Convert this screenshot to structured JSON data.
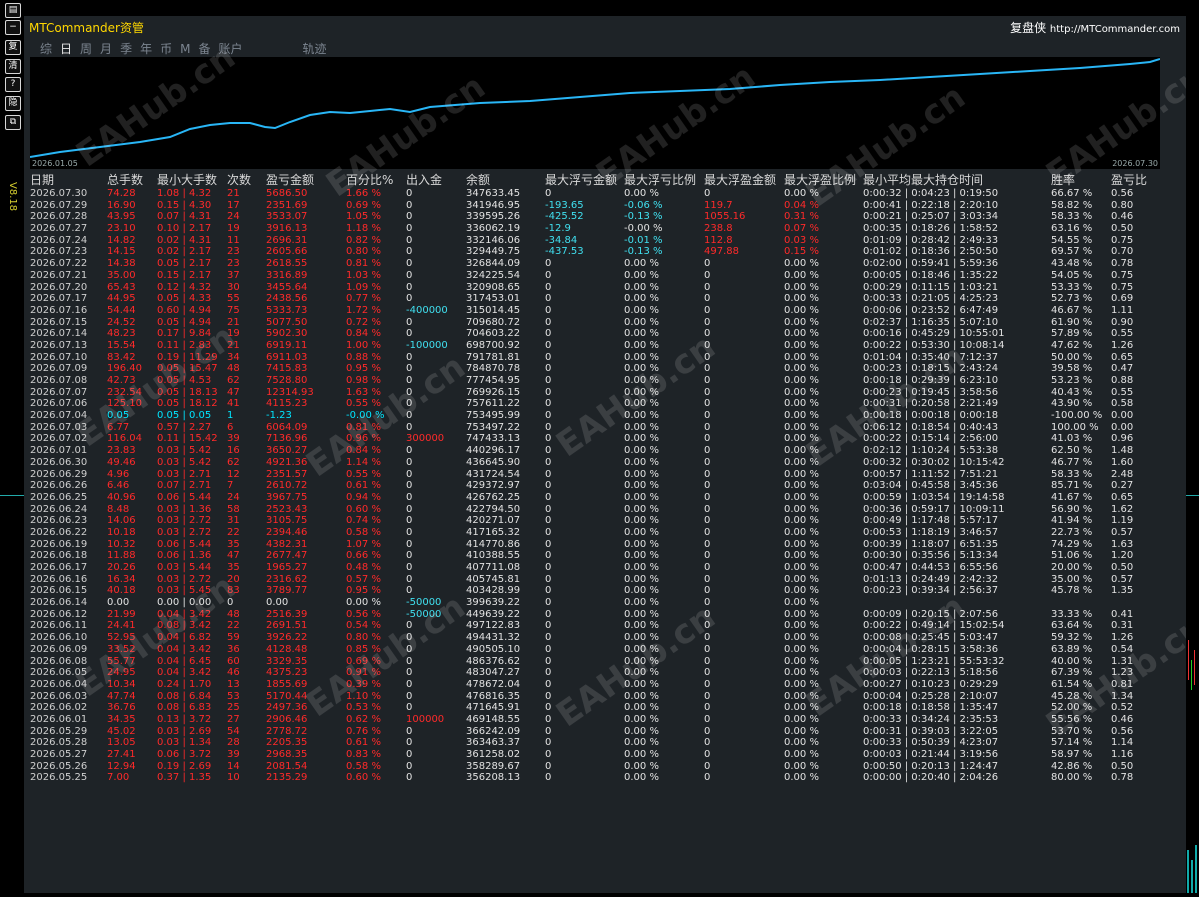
{
  "window": {
    "title": "MTCommander资管",
    "brand": "复盘侠",
    "url": "http://MTCommander.com",
    "version": "V8.18"
  },
  "tabs": [
    "综",
    "日",
    "周",
    "月",
    "季",
    "年",
    "币",
    "M",
    "备",
    "账户",
    "轨迹"
  ],
  "active_tab": "日",
  "chart": {
    "start_label": "2026.01.05",
    "end_label": "2026.07.30",
    "line_color": "#29b6f6"
  },
  "watermark": "EAHub.cn",
  "table": {
    "headers": [
      "日期",
      "总手数",
      "最小大手数",
      "次数",
      "盈亏金额",
      "百分比%",
      "出入金",
      "余额",
      "最大浮亏金额",
      "最大浮亏比例",
      "最大浮盈金额",
      "最大浮盈比例",
      "最小平均最大持仓时间",
      "胜率",
      "盈亏比"
    ],
    "rows": [
      [
        "2026.07.30",
        "74.28",
        "1.08 | 4.32",
        "21",
        "5686.50",
        "1.66 %",
        "0",
        "347633.45",
        "0",
        "0.00 %",
        "0",
        "0.00 %",
        "0:00:32 | 0:04:23 | 0:19:50",
        "66.67 %",
        "0.56"
      ],
      [
        "2026.07.29",
        "16.90",
        "0.15 | 4.30",
        "17",
        "2351.69",
        "0.69 %",
        "0",
        "341946.95",
        "-193.65",
        "-0.06 %",
        "119.7",
        "0.04 %",
        "0:00:41 | 0:22:18 | 2:20:10",
        "58.82 %",
        "0.80"
      ],
      [
        "2026.07.28",
        "43.95",
        "0.07 | 4.31",
        "24",
        "3533.07",
        "1.05 %",
        "0",
        "339595.26",
        "-425.52",
        "-0.13 %",
        "1055.16",
        "0.31 %",
        "0:00:21 | 0:25:07 | 3:03:34",
        "58.33 %",
        "0.46"
      ],
      [
        "2026.07.27",
        "23.10",
        "0.10 | 2.17",
        "19",
        "3916.13",
        "1.18 %",
        "0",
        "336062.19",
        "-12.9",
        "-0.00 %",
        "238.8",
        "0.07 %",
        "0:00:35 | 0:18:26 | 1:58:52",
        "63.16 %",
        "0.50"
      ],
      [
        "2026.07.24",
        "14.82",
        "0.02 | 4.31",
        "11",
        "2696.31",
        "0.82 %",
        "0",
        "332146.06",
        "-34.84",
        "-0.01 %",
        "112.8",
        "0.03 %",
        "0:01:09 | 0:28:42 | 2:49:33",
        "54.55 %",
        "0.75"
      ],
      [
        "2026.07.23",
        "14.15",
        "0.02 | 2.17",
        "23",
        "2605.66",
        "0.80 %",
        "0",
        "329449.75",
        "-437.53",
        "-0.13 %",
        "497.88",
        "0.15 %",
        "0:01:02 | 0:18:36 | 2:50:50",
        "69.57 %",
        "0.70"
      ],
      [
        "2026.07.22",
        "14.38",
        "0.05 | 2.17",
        "23",
        "2618.55",
        "0.81 %",
        "0",
        "326844.09",
        "0",
        "0.00 %",
        "0",
        "0.00 %",
        "0:02:00 | 0:59:41 | 5:59:36",
        "43.48 %",
        "0.78"
      ],
      [
        "2026.07.21",
        "35.00",
        "0.15 | 2.17",
        "37",
        "3316.89",
        "1.03 %",
        "0",
        "324225.54",
        "0",
        "0.00 %",
        "0",
        "0.00 %",
        "0:00:05 | 0:18:46 | 1:35:22",
        "54.05 %",
        "0.75"
      ],
      [
        "2026.07.20",
        "65.43",
        "0.12 | 4.32",
        "30",
        "3455.64",
        "1.09 %",
        "0",
        "320908.65",
        "0",
        "0.00 %",
        "0",
        "0.00 %",
        "0:00:29 | 0:11:15 | 1:03:21",
        "53.33 %",
        "0.75"
      ],
      [
        "2026.07.17",
        "44.95",
        "0.05 | 4.33",
        "55",
        "2438.56",
        "0.77 %",
        "0",
        "317453.01",
        "0",
        "0.00 %",
        "0",
        "0.00 %",
        "0:00:33 | 0:21:05 | 4:25:23",
        "52.73 %",
        "0.69"
      ],
      [
        "2026.07.16",
        "54.44",
        "0.60 | 4.94",
        "75",
        "5333.73",
        "1.72 %",
        "-400000",
        "315014.45",
        "0",
        "0.00 %",
        "0",
        "0.00 %",
        "0:00:06 | 0:23:52 | 6:47:49",
        "46.67 %",
        "1.11"
      ],
      [
        "2026.07.15",
        "24.52",
        "0.05 | 4.94",
        "21",
        "5077.50",
        "0.72 %",
        "0",
        "709680.72",
        "0",
        "0.00 %",
        "0",
        "0.00 %",
        "0:02:37 | 1:16:35 | 5:07:10",
        "61.90 %",
        "0.90"
      ],
      [
        "2026.07.14",
        "48.23",
        "0.17 | 9.84",
        "19",
        "5902.30",
        "0.84 %",
        "0",
        "704603.22",
        "0",
        "0.00 %",
        "0",
        "0.00 %",
        "0:00:16 | 0:45:29 | 10:55:01",
        "57.89 %",
        "0.55"
      ],
      [
        "2026.07.13",
        "15.54",
        "0.11 | 2.83",
        "21",
        "6919.11",
        "1.00 %",
        "-100000",
        "698700.92",
        "0",
        "0.00 %",
        "0",
        "0.00 %",
        "0:00:22 | 0:53:30 | 10:08:14",
        "47.62 %",
        "1.26"
      ],
      [
        "2026.07.10",
        "83.42",
        "0.19 | 11.29",
        "34",
        "6911.03",
        "0.88 %",
        "0",
        "791781.81",
        "0",
        "0.00 %",
        "0",
        "0.00 %",
        "0:01:04 | 0:35:40 | 7:12:37",
        "50.00 %",
        "0.65"
      ],
      [
        "2026.07.09",
        "196.40",
        "0.05 | 15.47",
        "48",
        "7415.83",
        "0.95 %",
        "0",
        "784870.78",
        "0",
        "0.00 %",
        "0",
        "0.00 %",
        "0:00:23 | 0:18:15 | 2:43:24",
        "39.58 %",
        "0.47"
      ],
      [
        "2026.07.08",
        "42.73",
        "0.05 | 4.53",
        "62",
        "7528.80",
        "0.98 %",
        "0",
        "777454.95",
        "0",
        "0.00 %",
        "0",
        "0.00 %",
        "0:00:18 | 0:29:39 | 6:23:10",
        "53.23 %",
        "0.88"
      ],
      [
        "2026.07.07",
        "232.54",
        "0.05 | 18.13",
        "47",
        "12314.93",
        "1.63 %",
        "0",
        "769926.15",
        "0",
        "0.00 %",
        "0",
        "0.00 %",
        "0:00:23 | 0:19:45 | 3:58:56",
        "40.43 %",
        "0.55"
      ],
      [
        "2026.07.06",
        "125.10",
        "0.05 | 18.12",
        "41",
        "4115.23",
        "0.55 %",
        "0",
        "757611.22",
        "0",
        "0.00 %",
        "0",
        "0.00 %",
        "0:00:31 | 0:20:58 | 2:21:49",
        "43.90 %",
        "0.58"
      ],
      [
        "2026.07.04",
        "0.05",
        "0.05 | 0.05",
        "1",
        "-1.23",
        "-0.00 %",
        "0",
        "753495.99",
        "0",
        "0.00 %",
        "0",
        "0.00 %",
        "0:00:18 | 0:00:18 | 0:00:18",
        "-100.00 %",
        "0.00"
      ],
      [
        "2026.07.03",
        "6.77",
        "0.57 | 2.27",
        "6",
        "6064.09",
        "0.81 %",
        "0",
        "753497.22",
        "0",
        "0.00 %",
        "0",
        "0.00 %",
        "0:06:12 | 0:18:54 | 0:40:43",
        "100.00 %",
        "0.00"
      ],
      [
        "2026.07.02",
        "116.04",
        "0.11 | 15.42",
        "39",
        "7136.96",
        "0.96 %",
        "300000",
        "747433.13",
        "0",
        "0.00 %",
        "0",
        "0.00 %",
        "0:00:22 | 0:15:14 | 2:56:00",
        "41.03 %",
        "0.96"
      ],
      [
        "2026.07.01",
        "23.83",
        "0.03 | 5.42",
        "16",
        "3650.27",
        "0.84 %",
        "0",
        "440296.17",
        "0",
        "0.00 %",
        "0",
        "0.00 %",
        "0:02:12 | 1:10:24 | 5:53:38",
        "62.50 %",
        "1.48"
      ],
      [
        "2026.06.30",
        "49.46",
        "0.03 | 5.42",
        "62",
        "4921.36",
        "1.14 %",
        "0",
        "436645.90",
        "0",
        "0.00 %",
        "0",
        "0.00 %",
        "0:00:32 | 0:30:02 | 10:15:42",
        "46.77 %",
        "1.60"
      ],
      [
        "2026.06.29",
        "4.96",
        "0.03 | 2.71",
        "12",
        "2351.57",
        "0.55 %",
        "0",
        "431724.54",
        "0",
        "0.00 %",
        "0",
        "0.00 %",
        "0:00:57 | 1:11:52 | 7:51:21",
        "58.33 %",
        "2.48"
      ],
      [
        "2026.06.26",
        "6.46",
        "0.07 | 2.71",
        "7",
        "2610.72",
        "0.61 %",
        "0",
        "429372.97",
        "0",
        "0.00 %",
        "0",
        "0.00 %",
        "0:03:04 | 0:45:58 | 3:45:36",
        "85.71 %",
        "0.27"
      ],
      [
        "2026.06.25",
        "40.96",
        "0.06 | 5.44",
        "24",
        "3967.75",
        "0.94 %",
        "0",
        "426762.25",
        "0",
        "0.00 %",
        "0",
        "0.00 %",
        "0:00:59 | 1:03:54 | 19:14:58",
        "41.67 %",
        "0.65"
      ],
      [
        "2026.06.24",
        "8.48",
        "0.03 | 1.36",
        "58",
        "2523.43",
        "0.60 %",
        "0",
        "422794.50",
        "0",
        "0.00 %",
        "0",
        "0.00 %",
        "0:00:36 | 0:59:17 | 10:09:11",
        "56.90 %",
        "1.62"
      ],
      [
        "2026.06.23",
        "14.06",
        "0.03 | 2.72",
        "31",
        "3105.75",
        "0.74 %",
        "0",
        "420271.07",
        "0",
        "0.00 %",
        "0",
        "0.00 %",
        "0:00:49 | 1:17:48 | 5:57:17",
        "41.94 %",
        "1.19"
      ],
      [
        "2026.06.22",
        "10.18",
        "0.03 | 2.72",
        "22",
        "2394.46",
        "0.58 %",
        "0",
        "417165.32",
        "0",
        "0.00 %",
        "0",
        "0.00 %",
        "0:00:53 | 1:18:19 | 3:46:57",
        "22.73 %",
        "0.57"
      ],
      [
        "2026.06.19",
        "10.32",
        "0.06 | 5.44",
        "35",
        "4382.31",
        "1.07 %",
        "0",
        "414770.86",
        "0",
        "0.00 %",
        "0",
        "0.00 %",
        "0:00:39 | 1:18:07 | 6:51:35",
        "74.29 %",
        "1.63"
      ],
      [
        "2026.06.18",
        "11.88",
        "0.06 | 1.36",
        "47",
        "2677.47",
        "0.66 %",
        "0",
        "410388.55",
        "0",
        "0.00 %",
        "0",
        "0.00 %",
        "0:00:30 | 0:35:56 | 5:13:34",
        "51.06 %",
        "1.20"
      ],
      [
        "2026.06.17",
        "20.26",
        "0.03 | 5.44",
        "35",
        "1965.27",
        "0.48 %",
        "0",
        "407711.08",
        "0",
        "0.00 %",
        "0",
        "0.00 %",
        "0:00:47 | 0:44:53 | 6:55:56",
        "20.00 %",
        "0.50"
      ],
      [
        "2026.06.16",
        "16.34",
        "0.03 | 2.72",
        "20",
        "2316.62",
        "0.57 %",
        "0",
        "405745.81",
        "0",
        "0.00 %",
        "0",
        "0.00 %",
        "0:01:13 | 0:24:49 | 2:42:32",
        "35.00 %",
        "0.57"
      ],
      [
        "2026.06.15",
        "40.18",
        "0.03 | 5.45",
        "83",
        "3789.77",
        "0.95 %",
        "0",
        "403428.99",
        "0",
        "0.00 %",
        "0",
        "0.00 %",
        "0:00:23 | 0:39:34 | 2:56:37",
        "45.78 %",
        "1.35"
      ],
      [
        "2026.06.14",
        "0.00",
        "0.00 | 0.00",
        "0",
        "0.00",
        "0.00 %",
        "-50000",
        "399639.22",
        "0",
        "0.00 %",
        "0",
        "0.00 %",
        "",
        "",
        ""
      ],
      [
        "2026.06.12",
        "21.99",
        "0.04 | 3.42",
        "48",
        "2516.39",
        "0.56 %",
        "-50000",
        "449639.22",
        "0",
        "0.00 %",
        "0",
        "0.00 %",
        "0:00:09 | 0:20:15 | 2:07:56",
        "33.33 %",
        "0.41"
      ],
      [
        "2026.06.11",
        "24.41",
        "0.08 | 3.42",
        "22",
        "2691.51",
        "0.54 %",
        "0",
        "497122.83",
        "0",
        "0.00 %",
        "0",
        "0.00 %",
        "0:00:22 | 0:49:14 | 15:02:54",
        "63.64 %",
        "0.31"
      ],
      [
        "2026.06.10",
        "52.95",
        "0.04 | 6.82",
        "59",
        "3926.22",
        "0.80 %",
        "0",
        "494431.32",
        "0",
        "0.00 %",
        "0",
        "0.00 %",
        "0:00:08 | 0:25:45 | 5:03:47",
        "59.32 %",
        "1.26"
      ],
      [
        "2026.06.09",
        "33.52",
        "0.04 | 3.42",
        "36",
        "4128.48",
        "0.85 %",
        "0",
        "490505.10",
        "0",
        "0.00 %",
        "0",
        "0.00 %",
        "0:00:04 | 0:28:15 | 3:58:36",
        "63.89 %",
        "0.54"
      ],
      [
        "2026.06.08",
        "55.77",
        "0.04 | 6.45",
        "60",
        "3329.35",
        "0.69 %",
        "0",
        "486376.62",
        "0",
        "0.00 %",
        "0",
        "0.00 %",
        "0:00:05 | 1:23:21 | 55:53:32",
        "40.00 %",
        "1.31"
      ],
      [
        "2026.06.05",
        "24.95",
        "0.04 | 3.42",
        "46",
        "4375.23",
        "0.91 %",
        "0",
        "483047.27",
        "0",
        "0.00 %",
        "0",
        "0.00 %",
        "0:00:03 | 0:22:13 | 5:18:56",
        "67.39 %",
        "1.23"
      ],
      [
        "2026.06.04",
        "10.34",
        "0.24 | 1.70",
        "13",
        "1855.69",
        "0.39 %",
        "0",
        "478672.04",
        "0",
        "0.00 %",
        "0",
        "0.00 %",
        "0:00:27 | 0:10:23 | 0:29:29",
        "61.54 %",
        "0.81"
      ],
      [
        "2026.06.03",
        "47.74",
        "0.08 | 6.84",
        "53",
        "5170.44",
        "1.10 %",
        "0",
        "476816.35",
        "0",
        "0.00 %",
        "0",
        "0.00 %",
        "0:00:04 | 0:25:28 | 2:10:07",
        "45.28 %",
        "1.34"
      ],
      [
        "2026.06.02",
        "36.76",
        "0.08 | 6.83",
        "25",
        "2497.36",
        "0.53 %",
        "0",
        "471645.91",
        "0",
        "0.00 %",
        "0",
        "0.00 %",
        "0:00:18 | 0:18:58 | 1:35:47",
        "52.00 %",
        "0.52"
      ],
      [
        "2026.06.01",
        "34.35",
        "0.13 | 3.72",
        "27",
        "2906.46",
        "0.62 %",
        "100000",
        "469148.55",
        "0",
        "0.00 %",
        "0",
        "0.00 %",
        "0:00:33 | 0:34:24 | 2:35:53",
        "55.56 %",
        "0.46"
      ],
      [
        "2026.05.29",
        "45.02",
        "0.03 | 2.69",
        "54",
        "2778.72",
        "0.76 %",
        "0",
        "366242.09",
        "0",
        "0.00 %",
        "0",
        "0.00 %",
        "0:00:31 | 0:39:03 | 3:22:05",
        "53.70 %",
        "0.56"
      ],
      [
        "2026.05.28",
        "13.05",
        "0.03 | 1.34",
        "28",
        "2205.35",
        "0.61 %",
        "0",
        "363463.37",
        "0",
        "0.00 %",
        "0",
        "0.00 %",
        "0:00:33 | 0:50:39 | 4:23:07",
        "57.14 %",
        "1.14"
      ],
      [
        "2026.05.27",
        "27.41",
        "0.06 | 3.72",
        "39",
        "2968.35",
        "0.83 %",
        "0",
        "361258.02",
        "0",
        "0.00 %",
        "0",
        "0.00 %",
        "0:00:03 | 0:21:44 | 3:19:56",
        "58.97 %",
        "1.16"
      ],
      [
        "2026.05.26",
        "12.94",
        "0.19 | 2.69",
        "14",
        "2081.54",
        "0.58 %",
        "0",
        "358289.67",
        "0",
        "0.00 %",
        "0",
        "0.00 %",
        "0:00:50 | 0:20:13 | 1:24:47",
        "42.86 %",
        "0.50"
      ],
      [
        "2026.05.25",
        "7.00",
        "0.37 | 1.35",
        "10",
        "2135.29",
        "0.60 %",
        "0",
        "356208.13",
        "0",
        "0.00 %",
        "0",
        "0.00 %",
        "0:00:00 | 0:20:40 | 2:04:26",
        "80.00 %",
        "0.78"
      ]
    ]
  }
}
